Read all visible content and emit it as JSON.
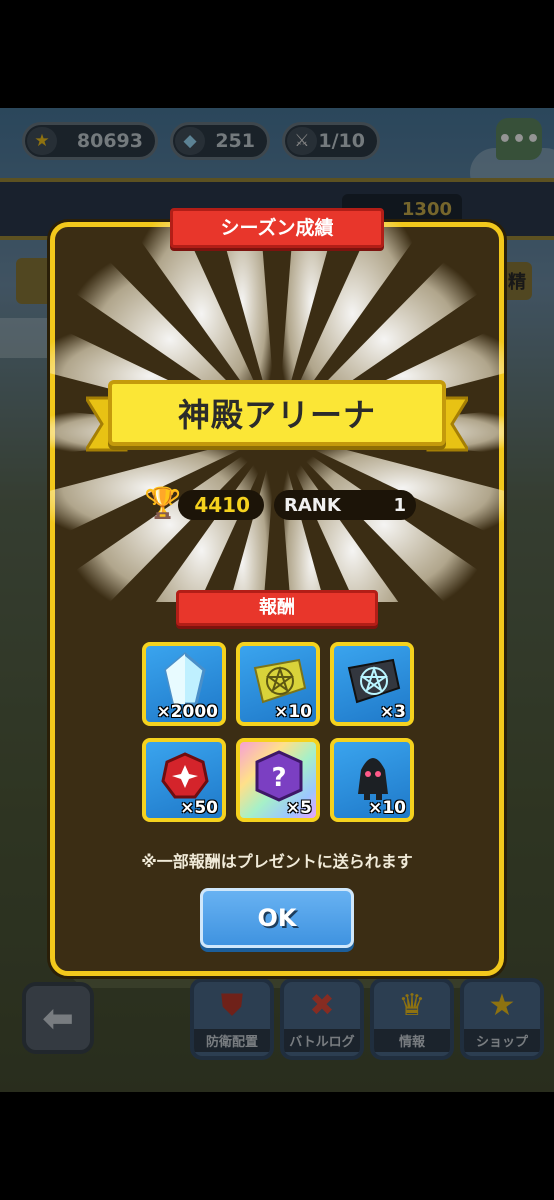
{
  "hud": {
    "medals": "80693",
    "crystals": "251",
    "stamina": "1/10",
    "chat_icon": "chat-bubble-icon"
  },
  "background": {
    "trophy_count": "1300",
    "right_tab_label": "精"
  },
  "modal": {
    "header": "シーズン成績",
    "arena_name": "神殿アリーナ",
    "trophies": "4410",
    "rank_label": "RANK",
    "rank_value": "1",
    "rewards_header": "報酬",
    "rewards": [
      {
        "icon": "crystal-icon",
        "qty": "×2000"
      },
      {
        "icon": "gold-pentagram-cloth-icon",
        "qty": "×10"
      },
      {
        "icon": "dark-pentagram-cloth-icon",
        "qty": "×3"
      },
      {
        "icon": "red-gem-icon",
        "qty": "×50"
      },
      {
        "icon": "mystery-box-icon",
        "qty": "×5"
      },
      {
        "icon": "shadow-figure-icon",
        "qty": "×10"
      }
    ],
    "note": "※一部報酬はプレゼントに送られます",
    "ok_label": "OK"
  },
  "nav": {
    "back_icon": "arrow-left-icon",
    "items": [
      {
        "label": "防衛配置",
        "icon": "shield-icon"
      },
      {
        "label": "バトルログ",
        "icon": "crossed-swords-icon"
      },
      {
        "label": "情報",
        "icon": "crown-icon"
      },
      {
        "label": "ショップ",
        "icon": "star-badge-icon"
      }
    ]
  }
}
